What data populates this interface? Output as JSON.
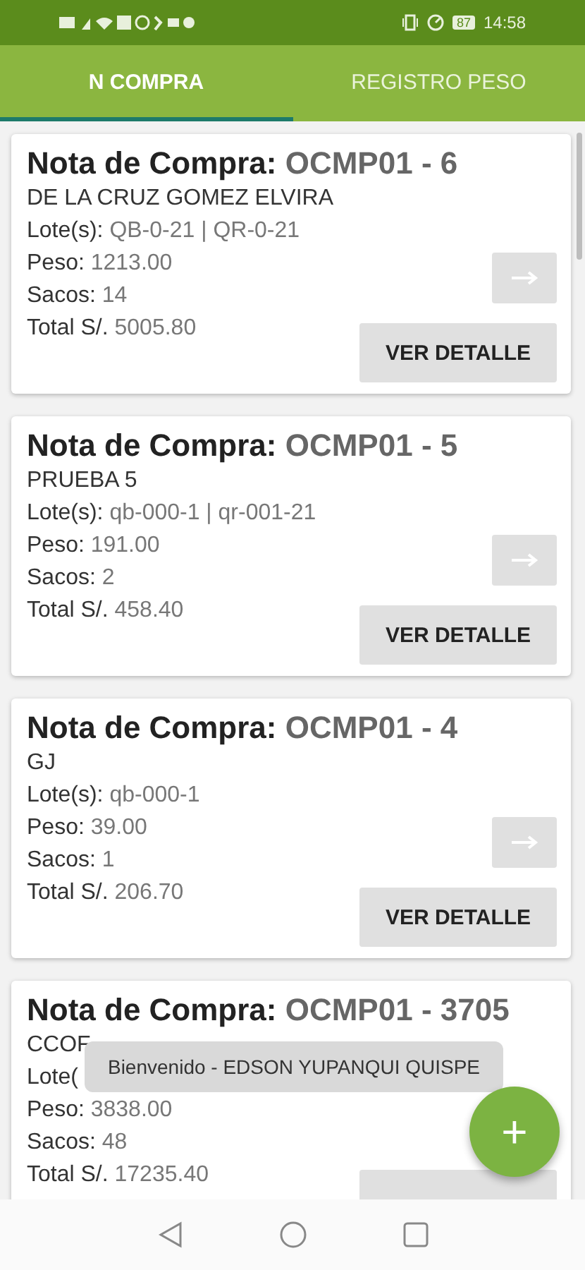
{
  "status_bar": {
    "battery": "87",
    "time": "14:58"
  },
  "tabs": [
    {
      "label": "N COMPRA",
      "selected": true
    },
    {
      "label": "REGISTRO PESO",
      "selected": false
    }
  ],
  "cards": [
    {
      "title_label": "Nota de Compra:",
      "code": "OCMP01 - 6",
      "name": "DE LA CRUZ GOMEZ ELVIRA",
      "lots_label": "Lote(s):",
      "lots": "QB-0-21 | QR-0-21",
      "peso_label": "Peso:",
      "peso": "1213.00",
      "sacos_label": "Sacos:",
      "sacos": "14",
      "total_label": "Total S/.",
      "total": "5005.80",
      "arrow_button": true,
      "detail_button": "VER DETALLE"
    },
    {
      "title_label": "Nota de Compra:",
      "code": "OCMP01 - 5",
      "name": "PRUEBA 5",
      "lots_label": "Lote(s):",
      "lots": "qb-000-1 | qr-001-21",
      "peso_label": "Peso:",
      "peso": "191.00",
      "sacos_label": "Sacos:",
      "sacos": "2",
      "total_label": "Total S/.",
      "total": "458.40",
      "arrow_button": true,
      "detail_button": "VER DETALLE"
    },
    {
      "title_label": "Nota de Compra:",
      "code": "OCMP01 - 4",
      "name": "GJ",
      "lots_label": "Lote(s):",
      "lots": "qb-000-1",
      "peso_label": "Peso:",
      "peso": "39.00",
      "sacos_label": "Sacos:",
      "sacos": "1",
      "total_label": "Total S/.",
      "total": "206.70",
      "arrow_button": true,
      "detail_button": "VER DETALLE"
    },
    {
      "title_label": "Nota de Compra:",
      "code": "OCMP01 - 3705",
      "name": "CCOF",
      "lots_label": "Lote(",
      "peso_label": "Peso:",
      "peso": "3838.00",
      "sacos_label": "Sacos:",
      "sacos": "48",
      "total_label": "Total S/.",
      "total": "17235.40",
      "arrow_button": false
    }
  ],
  "toast": "Bienvenido - EDSON YUPANQUI QUISPE",
  "fab": {
    "label": "+"
  }
}
